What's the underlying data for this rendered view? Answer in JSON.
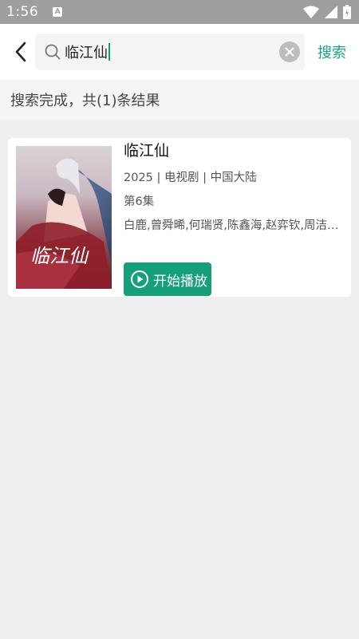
{
  "status_bar": {
    "time": "1:56",
    "badge": "A"
  },
  "search": {
    "query": "临江仙",
    "submit_label": "搜索"
  },
  "results": {
    "summary": "搜索完成，共(1)条结果",
    "items": [
      {
        "title": "临江仙",
        "meta": "2025 | 电视剧 | 中国大陆",
        "episode": "第6集",
        "cast": "白鹿,曾舜晞,何瑞贤,陈鑫海,赵弈钦,周洁…",
        "poster_text": "临江仙",
        "play_label": "开始播放"
      }
    ]
  },
  "colors": {
    "accent": "#16a07a",
    "status_bar": "#9e9e9e"
  }
}
